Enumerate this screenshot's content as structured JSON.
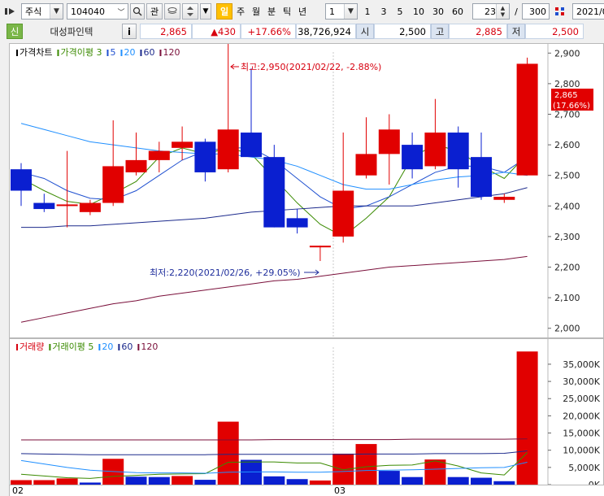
{
  "toolbar": {
    "market": "주식",
    "code": "104040",
    "btn_gwan": "관",
    "btn_day": "일",
    "btn_week": "주",
    "btn_month": "월",
    "btn_minute": "분",
    "btn_tick": "틱",
    "btn_year": "년",
    "period_select": "1",
    "intervals": [
      "1",
      "3",
      "5",
      "10",
      "30",
      "60"
    ],
    "count_value": "23",
    "slash": "/",
    "total_value": "300",
    "date_value": "2021/0"
  },
  "quote": {
    "badge": "신",
    "name": "대성파인텍",
    "info": "i",
    "price": "2,865",
    "change": "▲430",
    "change_pct": "+17.66%",
    "volume": "38,726,924",
    "open_label": "시",
    "open": "2,500",
    "high_label": "고",
    "high": "2,885",
    "low_label": "저",
    "low": "2,500"
  },
  "price_legend": [
    {
      "text": "가격차트",
      "color": "#000000"
    },
    {
      "text": "가격이평 3",
      "color": "#3a8a00"
    },
    {
      "text": "5",
      "color": "#1f50d0"
    },
    {
      "text": "20",
      "color": "#1f8fff"
    },
    {
      "text": "60",
      "color": "#1c2a8c"
    },
    {
      "text": "120",
      "color": "#7a0f3a"
    }
  ],
  "volume_legend": [
    {
      "text": "거래량",
      "color": "#d7000f"
    },
    {
      "text": "거래이평 5",
      "color": "#3a8a00"
    },
    {
      "text": "20",
      "color": "#1f8fff"
    },
    {
      "text": "60",
      "color": "#1c2a8c"
    },
    {
      "text": "120",
      "color": "#7a0f3a"
    }
  ],
  "annotations": {
    "high": "최고:2,950(2021/02/22, -2.88%)",
    "low": "최저:2,220(2021/02/26, +29.05%)"
  },
  "last_price_tag": {
    "price": "2,865",
    "pct": "(17.66%)"
  },
  "x_labels": [
    "02",
    "03"
  ],
  "colors": {
    "up": "#e10000",
    "down": "#0a1fd0",
    "grid": "#c8c8c8"
  },
  "chart_data": {
    "type": "candlestick",
    "price_axis": {
      "ticks": [
        2000,
        2100,
        2200,
        2300,
        2400,
        2500,
        2600,
        2700,
        2800,
        2900
      ],
      "labels": [
        "2,000",
        "2,100",
        "2,200",
        "2,300",
        "2,400",
        "2,500",
        "2,600",
        "2,700",
        "2,800",
        "2,900"
      ],
      "ylim": [
        1970,
        2930
      ]
    },
    "candles": [
      {
        "o": 2520,
        "h": 2540,
        "l": 2400,
        "c": 2450
      },
      {
        "o": 2410,
        "h": 2440,
        "l": 2380,
        "c": 2390
      },
      {
        "o": 2405,
        "h": 2580,
        "l": 2330,
        "c": 2405
      },
      {
        "o": 2380,
        "h": 2420,
        "l": 2370,
        "c": 2410
      },
      {
        "o": 2410,
        "h": 2680,
        "l": 2400,
        "c": 2530
      },
      {
        "o": 2510,
        "h": 2640,
        "l": 2500,
        "c": 2550
      },
      {
        "o": 2550,
        "h": 2610,
        "l": 2510,
        "c": 2580
      },
      {
        "o": 2590,
        "h": 2660,
        "l": 2550,
        "c": 2610
      },
      {
        "o": 2610,
        "h": 2620,
        "l": 2480,
        "c": 2510
      },
      {
        "o": 2520,
        "h": 2950,
        "l": 2510,
        "c": 2650
      },
      {
        "o": 2640,
        "h": 2850,
        "l": 2560,
        "c": 2560
      },
      {
        "o": 2560,
        "h": 2600,
        "l": 2330,
        "c": 2330
      },
      {
        "o": 2360,
        "h": 2390,
        "l": 2310,
        "c": 2330
      },
      {
        "o": 2270,
        "h": 2270,
        "l": 2220,
        "c": 2270
      },
      {
        "o": 2300,
        "h": 2640,
        "l": 2280,
        "c": 2450
      },
      {
        "o": 2500,
        "h": 2690,
        "l": 2490,
        "c": 2570
      },
      {
        "o": 2570,
        "h": 2700,
        "l": 2470,
        "c": 2650
      },
      {
        "o": 2600,
        "h": 2640,
        "l": 2490,
        "c": 2520
      },
      {
        "o": 2530,
        "h": 2750,
        "l": 2520,
        "c": 2640
      },
      {
        "o": 2640,
        "h": 2660,
        "l": 2460,
        "c": 2520
      },
      {
        "o": 2560,
        "h": 2640,
        "l": 2420,
        "c": 2430
      },
      {
        "o": 2420,
        "h": 2440,
        "l": 2410,
        "c": 2430
      },
      {
        "o": 2500,
        "h": 2885,
        "l": 2500,
        "c": 2865
      }
    ],
    "ma_price": [
      {
        "name": "3",
        "color": "#3a8a00",
        "values": [
          2490,
          2450,
          2415,
          2405,
          2440,
          2480,
          2560,
          2590,
          2570,
          2590,
          2570,
          2490,
          2410,
          2340,
          2300,
          2360,
          2430,
          2560,
          2600,
          2580,
          2530,
          2490,
          2570
        ]
      },
      {
        "name": "5",
        "color": "#1f50d0",
        "values": [
          2510,
          2490,
          2450,
          2425,
          2420,
          2450,
          2500,
          2550,
          2580,
          2590,
          2590,
          2550,
          2490,
          2430,
          2390,
          2400,
          2430,
          2470,
          2510,
          2530,
          2530,
          2510,
          2560
        ]
      },
      {
        "name": "20",
        "color": "#1f8fff",
        "values": [
          2670,
          2650,
          2630,
          2610,
          2600,
          2590,
          2580,
          2575,
          2570,
          2570,
          2560,
          2550,
          2530,
          2500,
          2470,
          2455,
          2455,
          2470,
          2485,
          2495,
          2500,
          2510,
          2500
        ]
      },
      {
        "name": "60",
        "color": "#1c2a8c",
        "values": [
          2330,
          2330,
          2335,
          2335,
          2340,
          2345,
          2350,
          2355,
          2360,
          2370,
          2380,
          2385,
          2390,
          2395,
          2400,
          2400,
          2400,
          2400,
          2410,
          2420,
          2430,
          2440,
          2460
        ]
      },
      {
        "name": "120",
        "color": "#7a0f3a",
        "values": [
          2020,
          2035,
          2050,
          2065,
          2080,
          2090,
          2105,
          2115,
          2125,
          2135,
          2145,
          2155,
          2160,
          2170,
          2180,
          2190,
          2200,
          2205,
          2210,
          2215,
          2220,
          2225,
          2235
        ]
      }
    ],
    "volume_axis": {
      "ticks": [
        0,
        5000,
        10000,
        15000,
        20000,
        25000,
        30000,
        35000
      ],
      "labels": [
        "0K",
        "5,000K",
        "10,000K",
        "15,000K",
        "20,000K",
        "25,000K",
        "30,000K",
        "35,000K"
      ],
      "ylim": [
        0,
        39000
      ]
    },
    "volume": [
      {
        "v": 1300,
        "up": true
      },
      {
        "v": 1300,
        "up": true
      },
      {
        "v": 1800,
        "up": true
      },
      {
        "v": 600,
        "up": false
      },
      {
        "v": 7500,
        "up": true
      },
      {
        "v": 2300,
        "up": false
      },
      {
        "v": 2200,
        "up": false
      },
      {
        "v": 2500,
        "up": true
      },
      {
        "v": 1400,
        "up": false
      },
      {
        "v": 18300,
        "up": true
      },
      {
        "v": 7200,
        "up": false
      },
      {
        "v": 2400,
        "up": false
      },
      {
        "v": 1600,
        "up": false
      },
      {
        "v": 1200,
        "up": true
      },
      {
        "v": 9000,
        "up": true
      },
      {
        "v": 11800,
        "up": true
      },
      {
        "v": 4000,
        "up": false
      },
      {
        "v": 2200,
        "up": false
      },
      {
        "v": 7300,
        "up": true
      },
      {
        "v": 2200,
        "up": false
      },
      {
        "v": 2000,
        "up": false
      },
      {
        "v": 1000,
        "up": false
      },
      {
        "v": 38700,
        "up": true
      }
    ],
    "ma_volume": [
      {
        "name": "5",
        "color": "#3a8a00",
        "values": [
          3000,
          2500,
          2000,
          1800,
          2400,
          2700,
          3000,
          3100,
          3200,
          6500,
          6600,
          6600,
          6300,
          6300,
          4300,
          5200,
          5600,
          5700,
          6900,
          5400,
          3400,
          2800,
          9300
        ]
      },
      {
        "name": "20",
        "color": "#1f8fff",
        "values": [
          7000,
          6000,
          5000,
          4200,
          3800,
          3500,
          3400,
          3400,
          3300,
          3600,
          3700,
          3700,
          3600,
          3600,
          3800,
          4100,
          4200,
          4300,
          4500,
          4700,
          4900,
          5000,
          6500
        ]
      },
      {
        "name": "60",
        "color": "#1c2a8c",
        "values": [
          9000,
          8900,
          8800,
          8700,
          8700,
          8700,
          8700,
          8700,
          8700,
          8800,
          8800,
          8800,
          8800,
          8800,
          8800,
          8900,
          8900,
          8900,
          9000,
          9000,
          9000,
          9100,
          9800
        ]
      },
      {
        "name": "120",
        "color": "#7a0f3a",
        "values": [
          13000,
          13000,
          13000,
          13000,
          13000,
          13000,
          13000,
          13000,
          13000,
          13000,
          13000,
          13100,
          13100,
          13100,
          13100,
          13100,
          13100,
          13200,
          13200,
          13200,
          13200,
          13200,
          13300
        ]
      }
    ]
  }
}
